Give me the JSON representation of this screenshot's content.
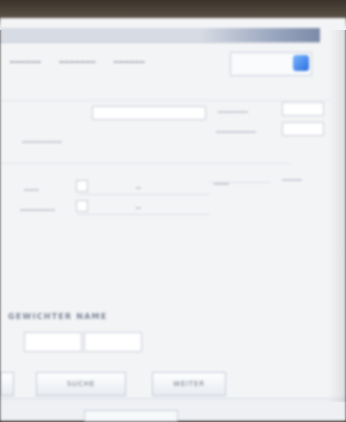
{
  "section": {
    "title": "GEWICHTER NAME"
  },
  "buttons": {
    "left": "SUCHE",
    "right": "WEITER"
  }
}
